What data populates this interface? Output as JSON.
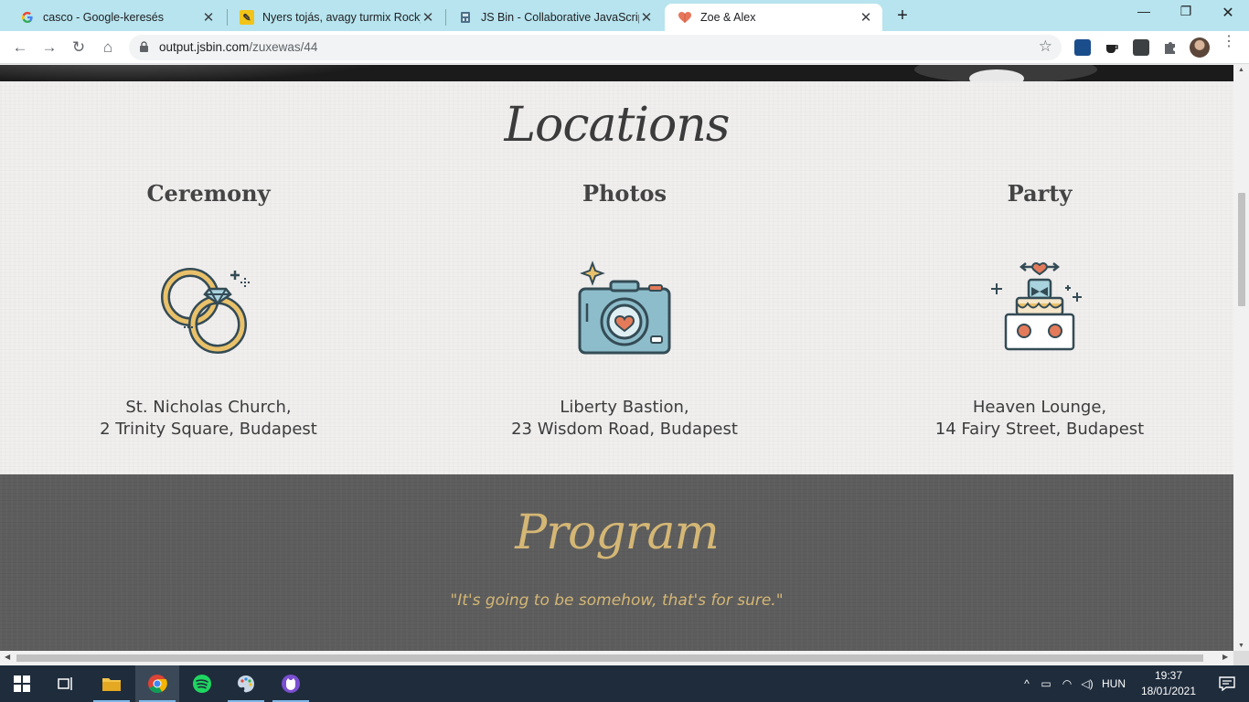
{
  "browser": {
    "tabs": [
      {
        "title": "casco - Google-keresés",
        "favicon": "google-icon"
      },
      {
        "title": "Nyers tojás, avagy turmix Rocky B",
        "favicon": "sticker-icon"
      },
      {
        "title": "JS Bin - Collaborative JavaScript D",
        "favicon": "jsbin-icon"
      },
      {
        "title": "Zoe & Alex",
        "favicon": "heart-icon",
        "active": true
      }
    ],
    "url_host": "output.jsbin.com",
    "url_path": "/zuxewas/44"
  },
  "page": {
    "locations_title": "Locations",
    "locations": [
      {
        "heading": "Ceremony",
        "icon": "rings-icon",
        "line1": "St. Nicholas Church,",
        "line2": "2 Trinity Square, Budapest"
      },
      {
        "heading": "Photos",
        "icon": "camera-icon",
        "line1": "Liberty Bastion,",
        "line2": "23 Wisdom Road, Budapest"
      },
      {
        "heading": "Party",
        "icon": "cake-icon",
        "line1": "Heaven Lounge,",
        "line2": "14 Fairy Street, Budapest"
      }
    ],
    "program_title": "Program",
    "program_quote": "\"It's going to be somehow, that's for sure.\""
  },
  "taskbar": {
    "language": "HUN",
    "time": "19:37",
    "date": "18/01/2021"
  },
  "colors": {
    "accent_gold": "#d5b775",
    "tab_strip": "#b7e4ee",
    "program_bg": "#5d5d5d"
  }
}
